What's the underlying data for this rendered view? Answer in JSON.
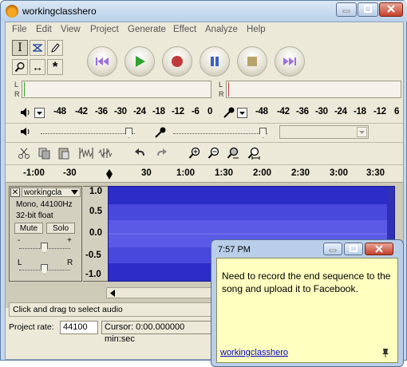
{
  "window": {
    "title": "workingclasshero"
  },
  "menu": [
    "File",
    "Edit",
    "View",
    "Project",
    "Generate",
    "Effect",
    "Analyze",
    "Help"
  ],
  "meters": {
    "play_letters": [
      "L",
      "R"
    ],
    "record_letters": [
      "L",
      "R"
    ],
    "scale": [
      "-48",
      "-42",
      "-36",
      "-30",
      "-24",
      "-18",
      "-12",
      "-6",
      "0"
    ],
    "scale2": [
      "-48",
      "-42",
      "-36",
      "-30",
      "-24",
      "-18",
      "-12",
      "6"
    ]
  },
  "timeline": {
    "ticks": [
      "-1:00",
      "-30",
      "30",
      "1:00",
      "1:30",
      "2:00",
      "2:30",
      "3:00",
      "3:30"
    ]
  },
  "track": {
    "name": "workingcla",
    "format": "Mono, 44100Hz",
    "bits": "32-bit float",
    "mute_label": "Mute",
    "solo_label": "Solo",
    "gain_minus": "-",
    "gain_plus": "+",
    "pan_left": "L",
    "pan_right": "R",
    "ruler": [
      "1.0",
      "0.5",
      "0.0",
      "-0.5",
      "-1.0"
    ]
  },
  "status": {
    "text": "Click and drag to select audio"
  },
  "selection": {
    "rate_label": "Project rate:",
    "rate_value": "44100",
    "cursor_label": "Cursor: 0:00.000000 min:sec"
  },
  "note": {
    "time": "7:57 PM",
    "text": "Need to record the end sequence to the song and upload it to Facebook.",
    "author": "workingclasshero"
  },
  "colors": {
    "waveform": "#2c2cc8",
    "note_background": "#ffffc0",
    "play_green": "#2fa32f",
    "record_red": "#c23a3a",
    "pause_blue": "#3d5fc8"
  }
}
